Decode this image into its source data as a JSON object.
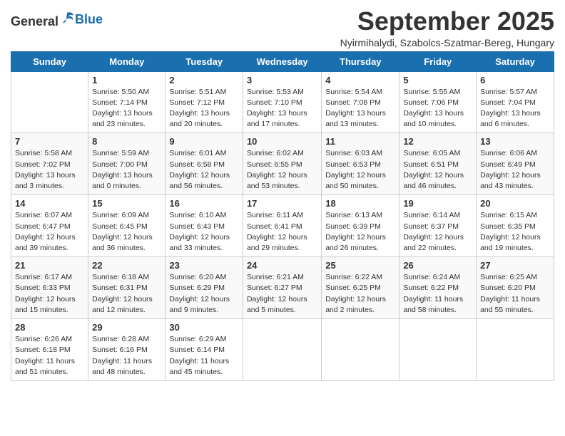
{
  "header": {
    "logo_general": "General",
    "logo_blue": "Blue",
    "title": "September 2025",
    "subtitle": "Nyirmihalydi, Szabolcs-Szatmar-Bereg, Hungary"
  },
  "weekdays": [
    "Sunday",
    "Monday",
    "Tuesday",
    "Wednesday",
    "Thursday",
    "Friday",
    "Saturday"
  ],
  "weeks": [
    [
      {
        "day": "",
        "info": ""
      },
      {
        "day": "1",
        "info": "Sunrise: 5:50 AM\nSunset: 7:14 PM\nDaylight: 13 hours\nand 23 minutes."
      },
      {
        "day": "2",
        "info": "Sunrise: 5:51 AM\nSunset: 7:12 PM\nDaylight: 13 hours\nand 20 minutes."
      },
      {
        "day": "3",
        "info": "Sunrise: 5:53 AM\nSunset: 7:10 PM\nDaylight: 13 hours\nand 17 minutes."
      },
      {
        "day": "4",
        "info": "Sunrise: 5:54 AM\nSunset: 7:08 PM\nDaylight: 13 hours\nand 13 minutes."
      },
      {
        "day": "5",
        "info": "Sunrise: 5:55 AM\nSunset: 7:06 PM\nDaylight: 13 hours\nand 10 minutes."
      },
      {
        "day": "6",
        "info": "Sunrise: 5:57 AM\nSunset: 7:04 PM\nDaylight: 13 hours\nand 6 minutes."
      }
    ],
    [
      {
        "day": "7",
        "info": "Sunrise: 5:58 AM\nSunset: 7:02 PM\nDaylight: 13 hours\nand 3 minutes."
      },
      {
        "day": "8",
        "info": "Sunrise: 5:59 AM\nSunset: 7:00 PM\nDaylight: 13 hours\nand 0 minutes."
      },
      {
        "day": "9",
        "info": "Sunrise: 6:01 AM\nSunset: 6:58 PM\nDaylight: 12 hours\nand 56 minutes."
      },
      {
        "day": "10",
        "info": "Sunrise: 6:02 AM\nSunset: 6:55 PM\nDaylight: 12 hours\nand 53 minutes."
      },
      {
        "day": "11",
        "info": "Sunrise: 6:03 AM\nSunset: 6:53 PM\nDaylight: 12 hours\nand 50 minutes."
      },
      {
        "day": "12",
        "info": "Sunrise: 6:05 AM\nSunset: 6:51 PM\nDaylight: 12 hours\nand 46 minutes."
      },
      {
        "day": "13",
        "info": "Sunrise: 6:06 AM\nSunset: 6:49 PM\nDaylight: 12 hours\nand 43 minutes."
      }
    ],
    [
      {
        "day": "14",
        "info": "Sunrise: 6:07 AM\nSunset: 6:47 PM\nDaylight: 12 hours\nand 39 minutes."
      },
      {
        "day": "15",
        "info": "Sunrise: 6:09 AM\nSunset: 6:45 PM\nDaylight: 12 hours\nand 36 minutes."
      },
      {
        "day": "16",
        "info": "Sunrise: 6:10 AM\nSunset: 6:43 PM\nDaylight: 12 hours\nand 33 minutes."
      },
      {
        "day": "17",
        "info": "Sunrise: 6:11 AM\nSunset: 6:41 PM\nDaylight: 12 hours\nand 29 minutes."
      },
      {
        "day": "18",
        "info": "Sunrise: 6:13 AM\nSunset: 6:39 PM\nDaylight: 12 hours\nand 26 minutes."
      },
      {
        "day": "19",
        "info": "Sunrise: 6:14 AM\nSunset: 6:37 PM\nDaylight: 12 hours\nand 22 minutes."
      },
      {
        "day": "20",
        "info": "Sunrise: 6:15 AM\nSunset: 6:35 PM\nDaylight: 12 hours\nand 19 minutes."
      }
    ],
    [
      {
        "day": "21",
        "info": "Sunrise: 6:17 AM\nSunset: 6:33 PM\nDaylight: 12 hours\nand 15 minutes."
      },
      {
        "day": "22",
        "info": "Sunrise: 6:18 AM\nSunset: 6:31 PM\nDaylight: 12 hours\nand 12 minutes."
      },
      {
        "day": "23",
        "info": "Sunrise: 6:20 AM\nSunset: 6:29 PM\nDaylight: 12 hours\nand 9 minutes."
      },
      {
        "day": "24",
        "info": "Sunrise: 6:21 AM\nSunset: 6:27 PM\nDaylight: 12 hours\nand 5 minutes."
      },
      {
        "day": "25",
        "info": "Sunrise: 6:22 AM\nSunset: 6:25 PM\nDaylight: 12 hours\nand 2 minutes."
      },
      {
        "day": "26",
        "info": "Sunrise: 6:24 AM\nSunset: 6:22 PM\nDaylight: 11 hours\nand 58 minutes."
      },
      {
        "day": "27",
        "info": "Sunrise: 6:25 AM\nSunset: 6:20 PM\nDaylight: 11 hours\nand 55 minutes."
      }
    ],
    [
      {
        "day": "28",
        "info": "Sunrise: 6:26 AM\nSunset: 6:18 PM\nDaylight: 11 hours\nand 51 minutes."
      },
      {
        "day": "29",
        "info": "Sunrise: 6:28 AM\nSunset: 6:16 PM\nDaylight: 11 hours\nand 48 minutes."
      },
      {
        "day": "30",
        "info": "Sunrise: 6:29 AM\nSunset: 6:14 PM\nDaylight: 11 hours\nand 45 minutes."
      },
      {
        "day": "",
        "info": ""
      },
      {
        "day": "",
        "info": ""
      },
      {
        "day": "",
        "info": ""
      },
      {
        "day": "",
        "info": ""
      }
    ]
  ]
}
